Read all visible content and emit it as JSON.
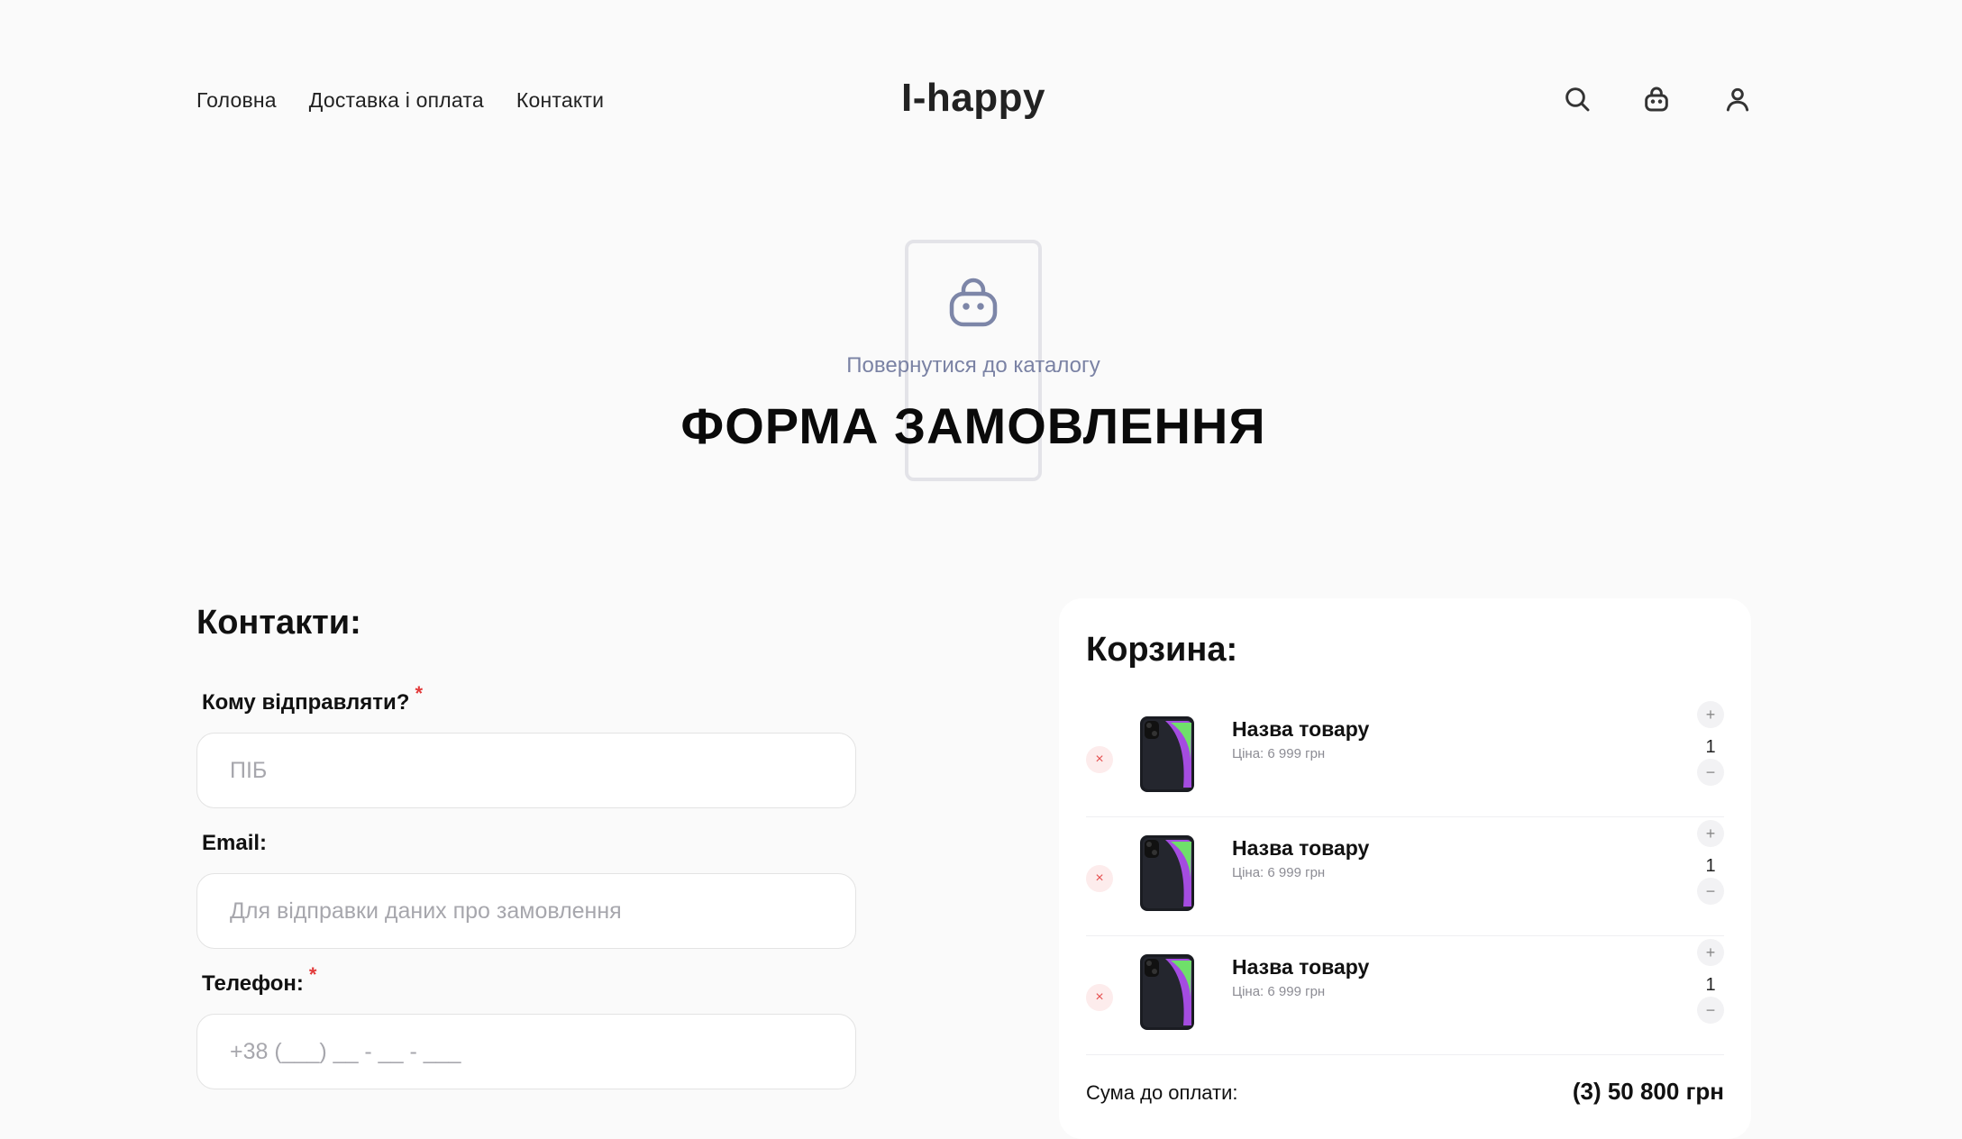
{
  "header": {
    "nav": [
      "Головна",
      "Доставка і оплата",
      "Контакти"
    ],
    "logo": "I-happy",
    "icons": [
      "search-icon",
      "cart-icon",
      "user-icon"
    ]
  },
  "hero": {
    "back_link": "Повернутися до каталогу",
    "title": "ФОРМА ЗАМОВЛЕННЯ",
    "icon": "shopping-bag-icon"
  },
  "contacts": {
    "title": "Контакти:",
    "fields": [
      {
        "label": "Кому відправляти?",
        "required": "*",
        "placeholder": "ПІБ",
        "value": ""
      },
      {
        "label": "Email:",
        "required": "",
        "placeholder": "Для відправки даних про замовлення",
        "value": ""
      },
      {
        "label": "Телефон:",
        "required": "*",
        "placeholder": "+38 (___) __ - __ - ___",
        "value": ""
      }
    ]
  },
  "cart": {
    "title": "Корзина:",
    "items": [
      {
        "name": "Назва товару",
        "price": "Ціна: 6 999 грн",
        "qty": "1",
        "plus": "+",
        "minus": "−",
        "remove": "×"
      },
      {
        "name": "Назва товару",
        "price": "Ціна: 6 999 грн",
        "qty": "1",
        "plus": "+",
        "minus": "−",
        "remove": "×"
      },
      {
        "name": "Назва товару",
        "price": "Ціна: 6 999 грн",
        "qty": "1",
        "plus": "+",
        "minus": "−",
        "remove": "×"
      }
    ],
    "sum_label": "Сума до оплати:",
    "sum_value": "(3) 50 800 грн"
  },
  "colors": {
    "accent": "#7a82a4",
    "required": "#e23a3a",
    "background": "#fafafa"
  }
}
